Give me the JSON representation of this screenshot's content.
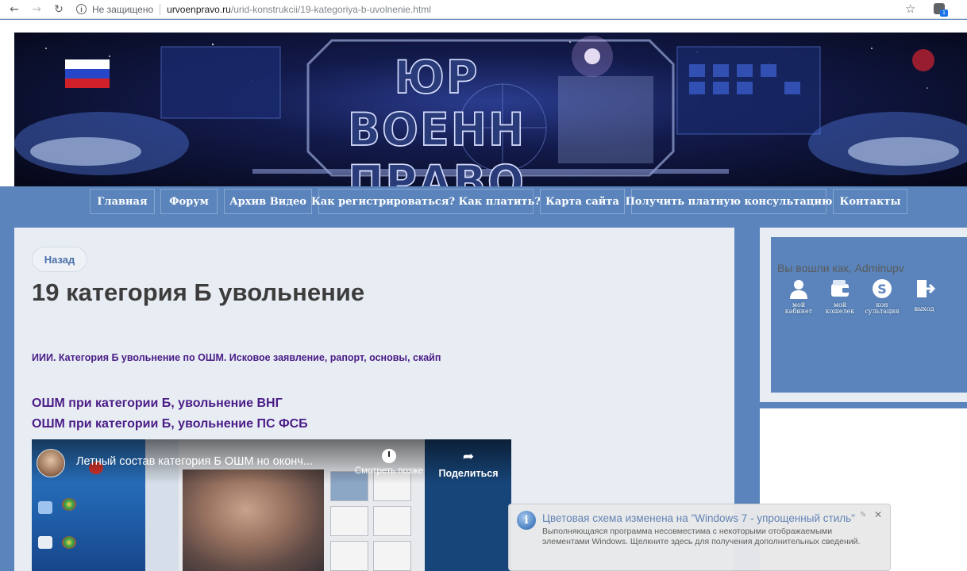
{
  "browser": {
    "security_label": "Не защищено",
    "url_host": "urvoenpravo.ru",
    "url_path": "/urid-konstrukcii/19-kategoriya-b-uvolnenie.html",
    "extension_badge": "1"
  },
  "banner": {
    "title": "ЮР ВОЕНН ПРАВО"
  },
  "nav": {
    "items": [
      {
        "label": "Главная"
      },
      {
        "label": "Форум"
      },
      {
        "label": "Архив Видео"
      },
      {
        "label": "Как регистрироваться? Как платить?"
      },
      {
        "label": "Карта сайта"
      },
      {
        "label": "Получить платную консультацию"
      },
      {
        "label": "Контакты"
      }
    ]
  },
  "content": {
    "back_label": "Назад",
    "title": "19 категория Б увольнение",
    "intro": "ИИИ. Категория Б увольнение по ОШМ. Исковое заявление, рапорт, основы, скайп",
    "link1": "ОШМ при категории Б, увольнение ВНГ",
    "link2": "ОШМ при категории Б, увольнение ПС ФСБ"
  },
  "video": {
    "title": "Летный состав категория Б ОШМ но оконч...",
    "watch_later": "Смотреть позже",
    "share": "Поделиться"
  },
  "account": {
    "greeting": "Вы вошли как, Adminupv",
    "items": [
      {
        "label_line1": "мой",
        "label_line2": "кабинет",
        "icon": "user-icon"
      },
      {
        "label_line1": "мой",
        "label_line2": "кошелек",
        "icon": "wallet-icon"
      },
      {
        "label_line1": "кон",
        "label_line2": "сультация",
        "icon": "skype-icon"
      },
      {
        "label_line1": "выход",
        "label_line2": "",
        "icon": "logout-icon"
      }
    ]
  },
  "notification": {
    "title": "Цветовая схема изменена на \"Windows 7 - упрощенный стиль\"",
    "text": "Выполняющаяся программа несовместима с некоторыми отображаемыми элементами Windows. Щелкните здесь для получения дополнительных сведений."
  },
  "colors": {
    "brand_blue": "#5a84bb",
    "content_bg": "#e8edf4",
    "link_purple": "#4a1c86"
  }
}
